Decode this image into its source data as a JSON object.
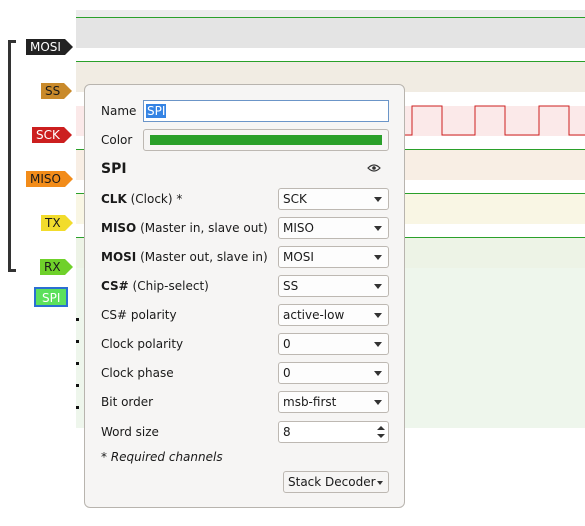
{
  "channels": [
    {
      "label": "MOSI",
      "bg": "#222222",
      "fg": "#ffffff"
    },
    {
      "label": "SS",
      "bg": "#c98a2b",
      "fg": "#1a1a1a"
    },
    {
      "label": "SCK",
      "bg": "#cc1f1f",
      "fg": "#ffffff"
    },
    {
      "label": "MISO",
      "bg": "#f28c1a",
      "fg": "#1a1a1a"
    },
    {
      "label": "TX",
      "bg": "#f2dc2c",
      "fg": "#1a1a1a"
    },
    {
      "label": "RX",
      "bg": "#6fd12a",
      "fg": "#1a1a1a"
    }
  ],
  "decoder_tag": {
    "label": "SPI",
    "bg": "#5ce05c",
    "fg": "#ffffff",
    "border": "#2a6fd1"
  },
  "dialog": {
    "name_label": "Name",
    "name_value": "SPI",
    "color_label": "Color",
    "color_value": "#2aa02a",
    "title": "SPI",
    "fields": [
      {
        "bold": "CLK",
        "rest": " (Clock) *",
        "value": "SCK"
      },
      {
        "bold": "MISO",
        "rest": " (Master in, slave out)",
        "value": "MISO"
      },
      {
        "bold": "MOSI",
        "rest": " (Master out, slave in)",
        "value": "MOSI"
      },
      {
        "bold": "CS#",
        "rest": " (Chip-select)",
        "value": "SS"
      },
      {
        "bold": "",
        "rest": "CS# polarity",
        "value": "active-low"
      },
      {
        "bold": "",
        "rest": "Clock polarity",
        "value": "0"
      },
      {
        "bold": "",
        "rest": "Clock phase",
        "value": "0"
      },
      {
        "bold": "",
        "rest": "Bit order",
        "value": "msb-first"
      }
    ],
    "word_size_label": "Word size",
    "word_size_value": "8",
    "required_note": "* Required channels",
    "stack_button": "Stack Decoder"
  }
}
